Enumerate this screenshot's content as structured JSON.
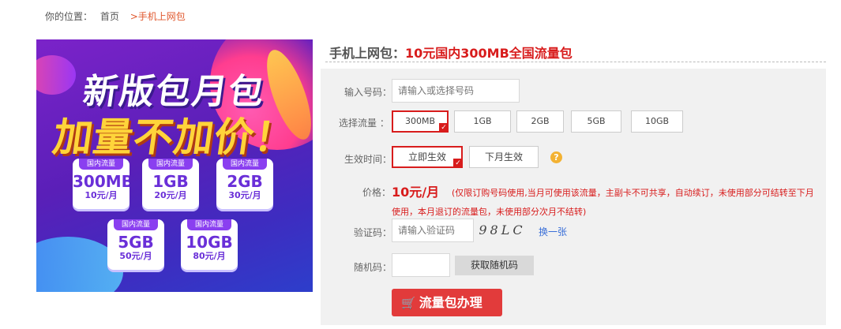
{
  "breadcrumb": {
    "label": "你的位置：",
    "home": "首页",
    "separator": ">",
    "current": "手机上网包"
  },
  "banner": {
    "headline1": "新版包月包",
    "headline2": "加量不加价！",
    "cards": [
      {
        "tag": "国内流量",
        "size": "300MB",
        "price": "10元/月"
      },
      {
        "tag": "国内流量",
        "size": "1GB",
        "price": "20元/月"
      },
      {
        "tag": "国内流量",
        "size": "2GB",
        "price": "30元/月"
      },
      {
        "tag": "国内流量",
        "size": "5GB",
        "price": "50元/月"
      },
      {
        "tag": "国内流量",
        "size": "10GB",
        "price": "80元/月"
      }
    ]
  },
  "product": {
    "prefix": "手机上网包：",
    "name": "10元国内300MB全国流量包"
  },
  "form": {
    "phone": {
      "label": "输入号码：",
      "placeholder": "请输入或选择号码"
    },
    "flow": {
      "label": "选择流量 ：",
      "options": [
        "300MB",
        "1GB",
        "2GB",
        "5GB",
        "10GB"
      ],
      "selected": "300MB"
    },
    "effective": {
      "label": "生效时间：",
      "options": [
        "立即生效",
        "下月生效"
      ],
      "selected": "立即生效",
      "help_icon": "question-icon"
    },
    "price": {
      "label": "价格：",
      "value": "10元/月",
      "note": "(仅限订购号码使用,当月可使用该流量，主副卡不可共享，自动续订，未使用部分可结转至下月使用，本月退订的流量包，未使用部分次月不结转)"
    },
    "captcha": {
      "label": "验证码：",
      "placeholder": "请输入验证码",
      "image_text": "98LC",
      "refresh": "换一张"
    },
    "random_code": {
      "label": "随机码：",
      "value": "",
      "button": "获取随机码"
    },
    "submit": {
      "icon": "cart-icon",
      "label": "流量包办理"
    }
  },
  "colors": {
    "accent": "#d81c1c",
    "link": "#3a6fd8",
    "panel_bg": "#f1f1f1",
    "submit_bg": "#e23b3b",
    "help": "#f3b233"
  }
}
